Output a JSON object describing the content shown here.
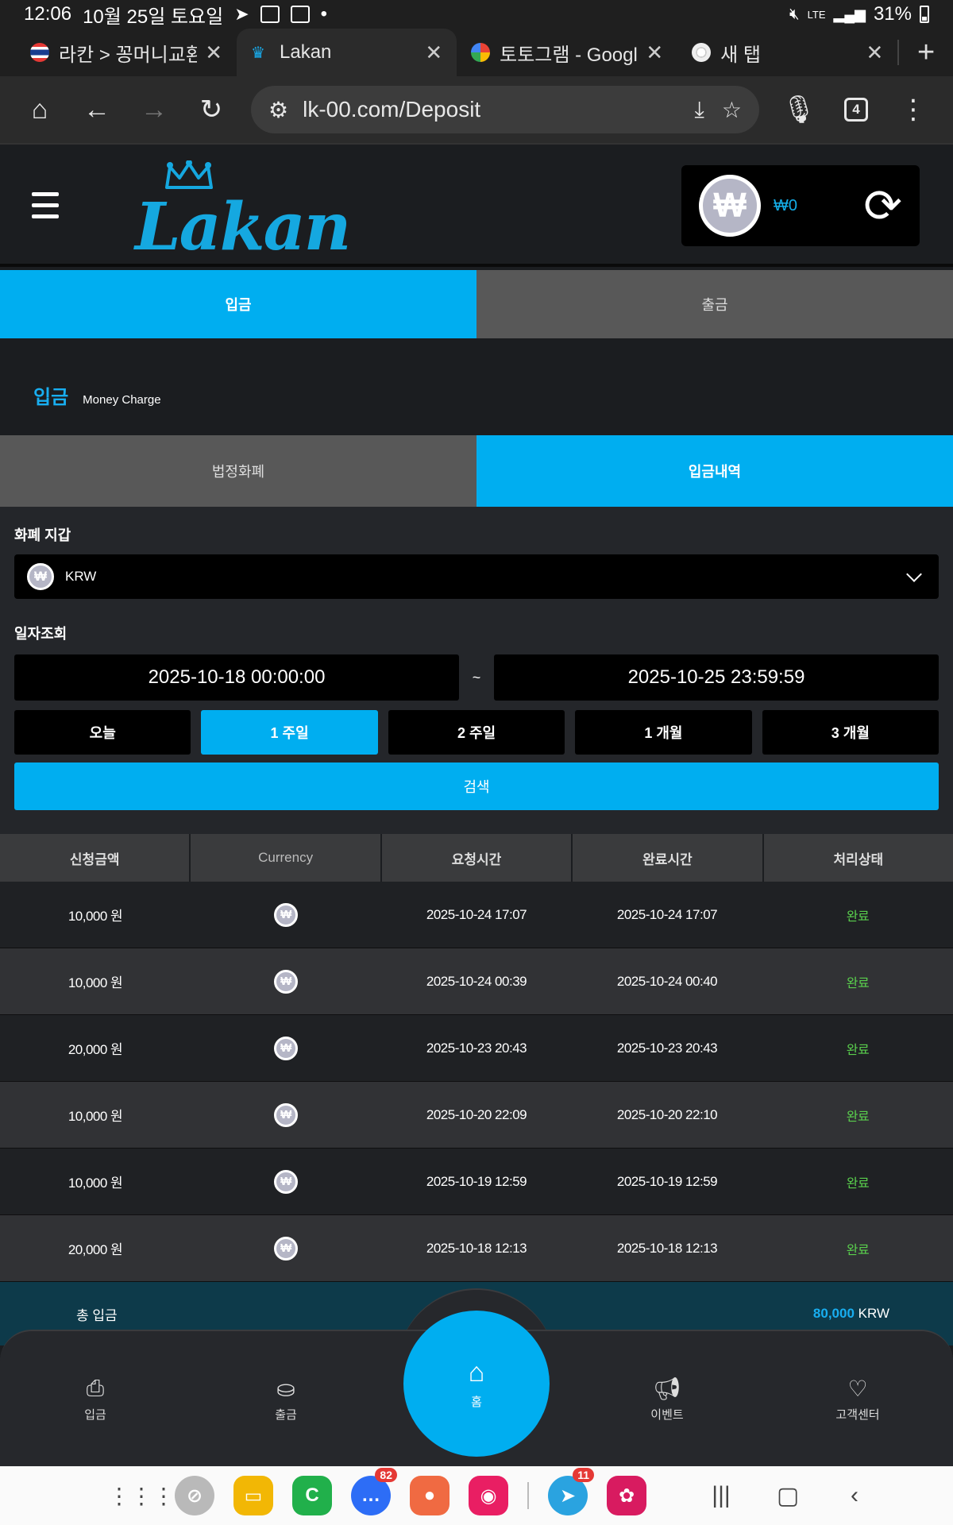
{
  "status_bar": {
    "time": "12:06",
    "date": "10월 25일 토요일",
    "network": "LTE",
    "battery": "31%"
  },
  "browser": {
    "tabs": [
      {
        "title": "라칸 > 꽁머니교환",
        "active": false
      },
      {
        "title": "Lakan",
        "active": true
      },
      {
        "title": "토토그램 - Google",
        "active": false
      },
      {
        "title": "새 탭",
        "active": false
      }
    ],
    "url": "lk-00.com/Deposit",
    "tab_count": "4"
  },
  "site": {
    "logo_text": "Lakan",
    "balance": "₩0",
    "currency_symbol": "₩"
  },
  "main_tabs": {
    "deposit": "입금",
    "withdraw": "출금"
  },
  "section": {
    "title_ko": "입금",
    "title_en": "Money Charge"
  },
  "sub_tabs": {
    "fiat": "법정화폐",
    "history": "입금내역"
  },
  "form": {
    "wallet_label": "화폐 지갑",
    "wallet_value": "KRW",
    "date_label": "일자조회",
    "date_from": "2025-10-18 00:00:00",
    "date_sep": "~",
    "date_to": "2025-10-25 23:59:59",
    "periods": [
      "오늘",
      "1 주일",
      "2 주일",
      "1 개월",
      "3 개월"
    ],
    "selected_period": "1 주일",
    "search_label": "검색"
  },
  "table": {
    "headers": [
      "신청금액",
      "Currency",
      "요청시간",
      "완료시간",
      "처리상태"
    ],
    "rows": [
      {
        "amount": "10,000 원",
        "requested": "2025-10-24 17:07",
        "completed": "2025-10-24 17:07",
        "status": "완료"
      },
      {
        "amount": "10,000 원",
        "requested": "2025-10-24 00:39",
        "completed": "2025-10-24 00:40",
        "status": "완료"
      },
      {
        "amount": "20,000 원",
        "requested": "2025-10-23 20:43",
        "completed": "2025-10-23 20:43",
        "status": "완료"
      },
      {
        "amount": "10,000 원",
        "requested": "2025-10-20 22:09",
        "completed": "2025-10-20 22:10",
        "status": "완료"
      },
      {
        "amount": "10,000 원",
        "requested": "2025-10-19 12:59",
        "completed": "2025-10-19 12:59",
        "status": "완료"
      },
      {
        "amount": "20,000 원",
        "requested": "2025-10-18 12:13",
        "completed": "2025-10-18 12:13",
        "status": "완료"
      }
    ]
  },
  "total": {
    "label": "총 입금",
    "amount": "80,000",
    "unit": "KRW"
  },
  "bottom_nav": {
    "deposit": "입금",
    "withdraw": "출금",
    "home": "홈",
    "event": "이벤트",
    "support": "고객센터"
  },
  "dock": {
    "messages_badge": "82",
    "telegram_badge": "11"
  },
  "colors": {
    "accent": "#00aef0",
    "status_ok": "#5ad04d",
    "bg": "#1b1d20"
  }
}
